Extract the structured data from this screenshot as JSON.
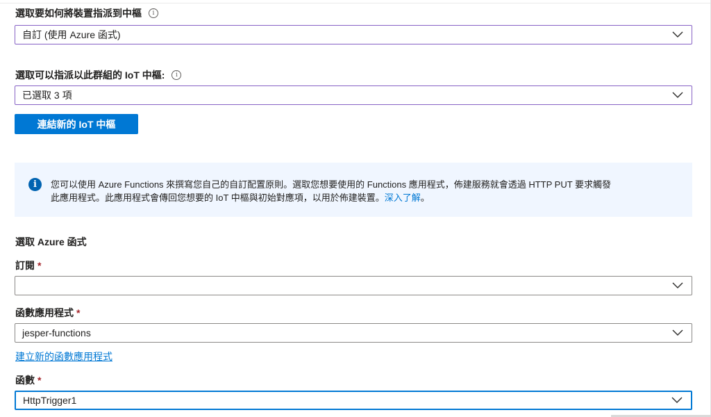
{
  "hub_assignment": {
    "label": "選取要如何將裝置指派到中樞",
    "value": "自訂 (使用 Azure 函式)"
  },
  "iot_hubs": {
    "label": "選取可以指派以此群組的 IoT 中樞:",
    "value": "已選取 3 項"
  },
  "link_hub_button": "連結新的 IoT 中樞",
  "info": {
    "text_line1": "您可以使用 Azure Functions 來撰寫您自己的自訂配置原則。選取您想要使用的 Functions 應用程式，佈建服務就會透過 HTTP PUT 要求觸發",
    "text_line2": "此應用程式。此應用程式會傳回您想要的 IoT 中樞與初始對應項，以用於佈建裝置。",
    "learn_more": "深入了解",
    "trailing": "。"
  },
  "function_section": {
    "heading": "選取 Azure 函式",
    "subscription": {
      "label": "訂閱",
      "required_mark": "*",
      "value": ""
    },
    "function_app": {
      "label": "函數應用程式",
      "required_mark": "*",
      "value": "jesper-functions"
    },
    "create_function_app_link": "建立新的函數應用程式",
    "function": {
      "label": "函數",
      "required_mark": "*",
      "value": "HttpTrigger1"
    }
  },
  "icons": {
    "info": "info-icon",
    "dropdown": "chevron-down-icon",
    "info_banner": "info-circle-icon"
  },
  "colors": {
    "accent": "#0078d4",
    "focus_border": "#8661c5",
    "info_background": "#f0f6ff",
    "required": "#a4262c"
  }
}
